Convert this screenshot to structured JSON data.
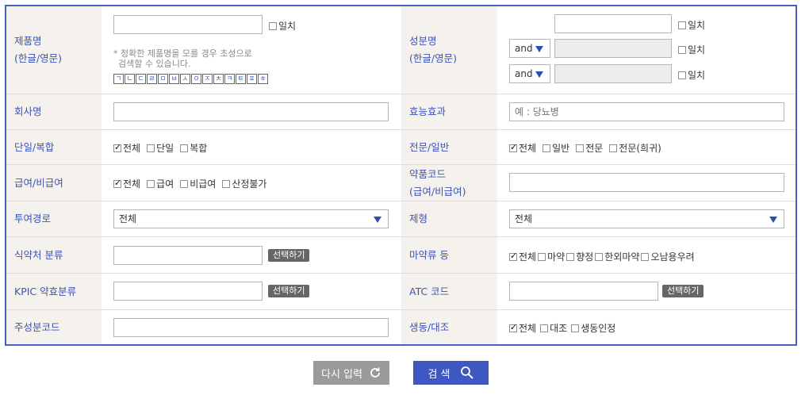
{
  "labels": {
    "product_name": "제품명",
    "product_name_sub": "(한글/영문)",
    "ingredient": "성분명",
    "ingredient_sub": "(한글/영문)",
    "company": "회사명",
    "efficacy": "효능효과",
    "single_combo": "단일/복합",
    "prof_general": "전문/일반",
    "coverage": "급여/비급여",
    "drug_code": "약품코드",
    "drug_code_sub": "(급여/비급여)",
    "route": "투여경로",
    "form": "제형",
    "mfds_class": "식약처 분류",
    "narcotic": "마약류 등",
    "kpic_class": "KPIC 약효분류",
    "atc": "ATC 코드",
    "main_ingredient_code": "주성분코드",
    "bioequiv": "생동/대조"
  },
  "exact": "일치",
  "hint_line1": "* 정확한 제품명을 모를 경우 초성으로",
  "hint_line2": "검색할 수 있습니다.",
  "consonants": [
    "ㄱ",
    "ㄴ",
    "ㄷ",
    "ㄹ",
    "ㅁ",
    "ㅂ",
    "ㅅ",
    "ㅇ",
    "ㅈ",
    "ㅊ",
    "ㅋ",
    "ㅌ",
    "ㅍ",
    "ㅎ"
  ],
  "and_label": "and",
  "efficacy_placeholder": "예 : 당뇨병",
  "route_value": "전체",
  "form_value": "전체",
  "pick_label": "선택하기",
  "single_combo_opts": [
    "전체",
    "단일",
    "복합"
  ],
  "prof_general_opts": [
    "전체",
    "일반",
    "전문",
    "전문(희귀)"
  ],
  "coverage_opts": [
    "전체",
    "급여",
    "비급여",
    "산정불가"
  ],
  "narcotic_opts": [
    "전체",
    "마약",
    "향정",
    "한외마약",
    "오남용우려"
  ],
  "bioequiv_opts": [
    "전체",
    "대조",
    "생동인정"
  ],
  "reset_label": "다시 입력",
  "search_label": "검 색",
  "colors": {
    "accent": "#4a5fc1",
    "label_bg": "#f5f2ee",
    "reset_bg": "#9a9a9a",
    "search_bg": "#3f57c0"
  }
}
